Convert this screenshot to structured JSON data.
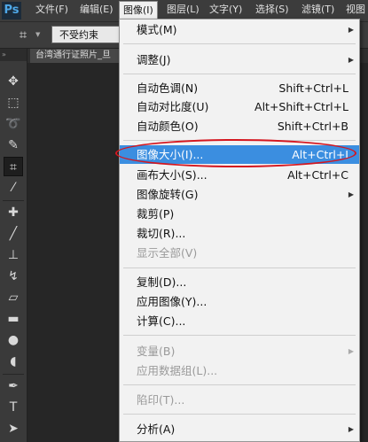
{
  "app": {
    "logo": "Ps"
  },
  "menubar": {
    "items": [
      "文件(F)",
      "编辑(E)",
      "图像(I)",
      "图层(L)",
      "文字(Y)",
      "选择(S)",
      "滤镜(T)",
      "视图"
    ],
    "active_index": 2
  },
  "options_bar": {
    "crop_tool_icon": "crop-icon",
    "ratio_select_value": "不受约束"
  },
  "document": {
    "tab_title": "台湾通行证照片_旦"
  },
  "tools": [
    "move-icon",
    "marquee-icon",
    "lasso-icon",
    "quick-select-icon",
    "crop-icon",
    "eyedropper-icon",
    "healing-brush-icon",
    "brush-icon",
    "clone-stamp-icon",
    "history-brush-icon",
    "eraser-icon",
    "gradient-icon",
    "blur-icon",
    "dodge-icon",
    "pen-icon",
    "type-icon",
    "path-select-icon",
    "shape-icon"
  ],
  "image_menu": {
    "mode": {
      "label": "模式(M)",
      "submenu": true
    },
    "adjustments": {
      "label": "调整(J)",
      "submenu": true
    },
    "auto_tone": {
      "label": "自动色调(N)",
      "shortcut": "Shift+Ctrl+L"
    },
    "auto_contrast": {
      "label": "自动对比度(U)",
      "shortcut": "Alt+Shift+Ctrl+L"
    },
    "auto_color": {
      "label": "自动颜色(O)",
      "shortcut": "Shift+Ctrl+B"
    },
    "image_size": {
      "label": "图像大小(I)...",
      "shortcut": "Alt+Ctrl+I",
      "highlighted": true
    },
    "canvas_size": {
      "label": "画布大小(S)...",
      "shortcut": "Alt+Ctrl+C"
    },
    "image_rotation": {
      "label": "图像旋转(G)",
      "submenu": true
    },
    "crop": {
      "label": "裁剪(P)"
    },
    "trim": {
      "label": "裁切(R)..."
    },
    "reveal_all": {
      "label": "显示全部(V)",
      "disabled": true
    },
    "duplicate": {
      "label": "复制(D)..."
    },
    "apply_image": {
      "label": "应用图像(Y)..."
    },
    "calculations": {
      "label": "计算(C)..."
    },
    "variables": {
      "label": "变量(B)",
      "submenu": true,
      "disabled": true
    },
    "apply_data_set": {
      "label": "应用数据组(L)...",
      "disabled": true
    },
    "trap": {
      "label": "陷印(T)...",
      "disabled": true
    },
    "analysis": {
      "label": "分析(A)",
      "submenu": true
    }
  },
  "colors": {
    "highlight": "#3b8ee0",
    "annotation_circle": "#d4161f",
    "menu_bg": "#f2f2f2",
    "app_bg": "#282828"
  }
}
